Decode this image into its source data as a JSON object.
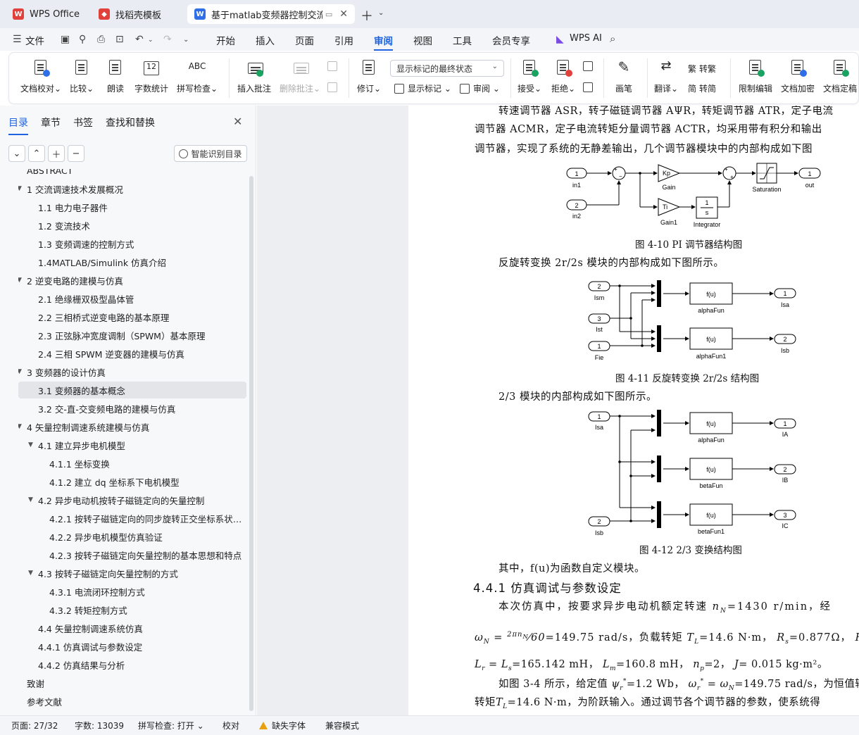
{
  "tabs": [
    {
      "label": "WPS Office",
      "icon": "wps-logo-icon",
      "color": "#e0413a",
      "active": false
    },
    {
      "label": "找稻壳模板",
      "icon": "docer-logo-icon",
      "color": "#e0413a",
      "active": false
    },
    {
      "label": "基于matlab变频器控制交流电",
      "icon": "wps-writer-icon",
      "color": "#2f6ee6",
      "active": true
    }
  ],
  "menu": {
    "file": "文件",
    "items": [
      "开始",
      "插入",
      "页面",
      "引用",
      "审阅",
      "视图",
      "工具",
      "会员专享"
    ],
    "active": "审阅",
    "ai": "WPS AI"
  },
  "ribbon": {
    "proofread": "文档校对",
    "compare": "比较",
    "read_aloud": "朗读",
    "word_count": "字数统计",
    "spell_check": "拼写检查",
    "spell_icon_text": "ABC",
    "insert_comment": "插入批注",
    "delete_comment": "删除批注",
    "revise": "修订",
    "markup_select": "显示标记的最终状态",
    "show_markup": "显示标记",
    "review": "审阅",
    "accept": "接受",
    "reject": "拒绝",
    "pen": "画笔",
    "translate": "翻译",
    "to_traditional": "转繁",
    "to_simplified": "转简",
    "restrict_edit": "限制编辑",
    "doc_encrypt": "文档加密",
    "doc_finalize": "文档定稿"
  },
  "nav": {
    "tabs": [
      "目录",
      "章节",
      "书签",
      "查找和替换"
    ],
    "active_tab": "目录",
    "smart_toc": "智能识别目录",
    "toc": [
      {
        "text": "ABSTRACT",
        "level": 1,
        "caret": ""
      },
      {
        "text": "1 交流调速技术发展概况",
        "level": 1,
        "caret": "open"
      },
      {
        "text": "1.1 电力电子器件",
        "level": 2,
        "caret": ""
      },
      {
        "text": "1.2 变流技术",
        "level": 2,
        "caret": ""
      },
      {
        "text": "1.3 变频调速的控制方式",
        "level": 2,
        "caret": ""
      },
      {
        "text": "1.4MATLAB/Simulink 仿真介绍",
        "level": 2,
        "caret": ""
      },
      {
        "text": "2 逆变电路的建模与仿真",
        "level": 1,
        "caret": "open"
      },
      {
        "text": "2.1 绝缘栅双极型晶体管",
        "level": 2,
        "caret": ""
      },
      {
        "text": "2.2 三相桥式逆变电路的基本原理",
        "level": 2,
        "caret": ""
      },
      {
        "text": "2.3 正弦脉冲宽度调制（SPWM）基本原理",
        "level": 2,
        "caret": ""
      },
      {
        "text": "2.4 三相 SPWM 逆变器的建模与仿真",
        "level": 2,
        "caret": ""
      },
      {
        "text": "3 变频器的设计仿真",
        "level": 1,
        "caret": "open"
      },
      {
        "text": "3.1 变频器的基本概念",
        "level": 2,
        "caret": "",
        "selected": true
      },
      {
        "text": "3.2 交-直-交变频电路的建模与仿真",
        "level": 2,
        "caret": ""
      },
      {
        "text": "4 矢量控制调速系统建模与仿真",
        "level": 1,
        "caret": "open"
      },
      {
        "text": "4.1  建立异步电机模型",
        "level": 2,
        "caret": "open"
      },
      {
        "text": "4.1.1  坐标变换",
        "level": 3,
        "caret": ""
      },
      {
        "text": "4.1.2  建立 dq 坐标系下电机模型",
        "level": 3,
        "caret": ""
      },
      {
        "text": "4.2  异步电动机按转子磁链定向的矢量控制",
        "level": 2,
        "caret": "open"
      },
      {
        "text": "4.2.1 按转子磁链定向的同步旋转正交坐标系状态方程",
        "level": 3,
        "caret": ""
      },
      {
        "text": "4.2.2  异步电机模型仿真验证",
        "level": 3,
        "caret": ""
      },
      {
        "text": "4.2.3  按转子磁链定向矢量控制的基本思想和特点",
        "level": 3,
        "caret": ""
      },
      {
        "text": "4.3  按转子磁链定向矢量控制的方式",
        "level": 2,
        "caret": "open"
      },
      {
        "text": "4.3.1  电流闭环控制方式",
        "level": 3,
        "caret": ""
      },
      {
        "text": "4.3.2  转矩控制方式",
        "level": 3,
        "caret": ""
      },
      {
        "text": "4.4  矢量控制调速系统仿真",
        "level": 2,
        "caret": ""
      },
      {
        "text": "4.4.1  仿真调试与参数设定",
        "level": 2,
        "caret": ""
      },
      {
        "text": "4.4.2  仿真结果与分析",
        "level": 2,
        "caret": ""
      },
      {
        "text": "致谢",
        "level": 1,
        "caret": ""
      },
      {
        "text": "参考文献",
        "level": 1,
        "caret": ""
      }
    ]
  },
  "doc": {
    "line1": "转速调节器 ASR，转子磁链调节器 AΨR，转矩调节器 ATR，定子电流",
    "line2": "调节器 ACMR，定子电流转矩分量调节器 ACTR，均采用带有积分和输出",
    "line3": "调节器，实现了系统的无静差输出，几个调节器模块中的内部构成如下图",
    "fig10": {
      "in1_num": "1",
      "in1": "in1",
      "in2_num": "2",
      "in2": "in2",
      "gain": "Gain",
      "gain_k": "Kp",
      "gain1": "Gain1",
      "gain1_k": "Ti",
      "integrator": "Integrator",
      "int_num": "1",
      "int_den": "s",
      "saturation": "Saturation",
      "out_num": "1",
      "out": "out",
      "caption": "图 4-10 PI 调节器结构图"
    },
    "para_2r2s": "反旋转变换 2r/2s 模块的内部构成如下图所示。",
    "fig11": {
      "ism_num": "2",
      "ism": "Ism",
      "ist_num": "3",
      "ist": "Ist",
      "fie_num": "1",
      "fie": "Fie",
      "fu": "f(u)",
      "alpha": "alphaFun",
      "alpha1": "alphaFun1",
      "isa_num": "1",
      "isa": "Isa",
      "isb_num": "2",
      "isb": "Isb",
      "caption": "图 4-11  反旋转变换 2r/2s 结构图"
    },
    "para_23": "2/3 模块的内部构成如下图所示。",
    "fig12": {
      "isa_num": "1",
      "isa": "Isa",
      "isb_num": "2",
      "isb": "Isb",
      "fu": "f(u)",
      "alpha": "alphaFun",
      "beta": "betaFun",
      "beta1": "betaFun1",
      "ia_num": "1",
      "ia": "IA",
      "ib_num": "2",
      "ib": "IB",
      "ic_num": "3",
      "ic": "IC",
      "caption": "图 4-12  2/3 变换结构图"
    },
    "para_fu": "其中，f(u)为函数自定义模块。",
    "heading": "4.4.1  仿真调试与参数设定",
    "para_sim1": "本次仿真中，按要求异步电动机额定转速",
    "para_sim1_val": "=1430 r/min，经",
    "para_sim2_val": "=149.75 rad/s，负载转矩",
    "para_sim2_tl": "=14.6 N·m，",
    "para_sim2_rs": "=0.877Ω，",
    "para_sim3": "=165.142 mH，",
    "para_sim3_lm": "=160.8 mH，",
    "para_sim3_np": "=2，",
    "para_sim3_j": "= 0.015 kg·m²。",
    "para_sim4a": "如图 3-4 所示，给定值",
    "para_sim4b": "=1.2 Wb，",
    "para_sim4c": "=149.75 rad/s，为恒值输",
    "para_sim5a": "转矩",
    "para_sim5b": "=14.6 N·m，为阶跃输入。通过调节各个调节器的参数，使系统得"
  },
  "status": {
    "page": "页面: 27/32",
    "words": "字数: 13039",
    "spell": "拼写检查: 打开",
    "proof": "校对",
    "missing_font": "缺失字体",
    "compat": "兼容模式"
  }
}
